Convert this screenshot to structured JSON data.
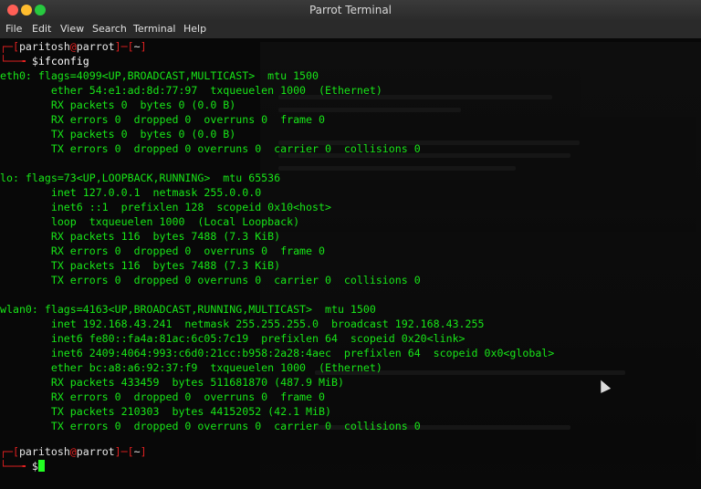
{
  "window": {
    "title": "Parrot Terminal"
  },
  "menu": [
    "File",
    "Edit",
    "View",
    "Search",
    "Terminal",
    "Help"
  ],
  "prompt": {
    "user": "paritosh",
    "at": "@",
    "host": "parrot",
    "dir": "~",
    "symbol": "$"
  },
  "command": "ifconfig",
  "output": [
    "eth0: flags=4099<UP,BROADCAST,MULTICAST>  mtu 1500",
    "        ether 54:e1:ad:8d:77:97  txqueuelen 1000  (Ethernet)",
    "        RX packets 0  bytes 0 (0.0 B)",
    "        RX errors 0  dropped 0  overruns 0  frame 0",
    "        TX packets 0  bytes 0 (0.0 B)",
    "        TX errors 0  dropped 0 overruns 0  carrier 0  collisions 0",
    "",
    "lo: flags=73<UP,LOOPBACK,RUNNING>  mtu 65536",
    "        inet 127.0.0.1  netmask 255.0.0.0",
    "        inet6 ::1  prefixlen 128  scopeid 0x10<host>",
    "        loop  txqueuelen 1000  (Local Loopback)",
    "        RX packets 116  bytes 7488 (7.3 KiB)",
    "        RX errors 0  dropped 0  overruns 0  frame 0",
    "        TX packets 116  bytes 7488 (7.3 KiB)",
    "        TX errors 0  dropped 0 overruns 0  carrier 0  collisions 0",
    "",
    "wlan0: flags=4163<UP,BROADCAST,RUNNING,MULTICAST>  mtu 1500",
    "        inet 192.168.43.241  netmask 255.255.255.0  broadcast 192.168.43.255",
    "        inet6 fe80::fa4a:81ac:6c05:7c19  prefixlen 64  scopeid 0x20<link>",
    "        inet6 2409:4064:993:c6d0:21cc:b958:2a28:4aec  prefixlen 64  scopeid 0x0<global>",
    "        ether bc:a8:a6:92:37:f9  txqueuelen 1000  (Ethernet)",
    "        RX packets 433459  bytes 511681870 (487.9 MiB)",
    "        RX errors 0  dropped 0  overruns 0  frame 0",
    "        TX packets 210303  bytes 44152052 (42.1 MiB)",
    "        TX errors 0  dropped 0 overruns 0  carrier 0  collisions 0"
  ],
  "colors": {
    "text": "#18e618",
    "prompt_bracket": "#e02020",
    "background": "#080808"
  }
}
